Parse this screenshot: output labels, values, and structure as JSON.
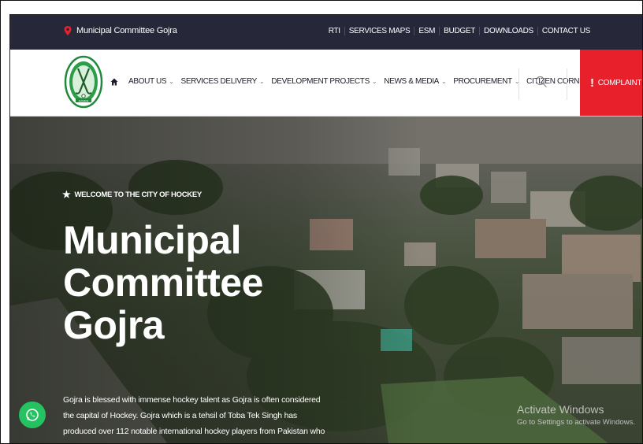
{
  "topbar": {
    "site_name": "Municipal Committee Gojra",
    "links": [
      "RTI",
      "SERVICES MAPS",
      "ESM",
      "BUDGET",
      "DOWNLOADS",
      "CONTACT US"
    ]
  },
  "nav": {
    "menu": [
      {
        "label": "ABOUT US"
      },
      {
        "label": "SERVICES DELIVERY"
      },
      {
        "label": "DEVELOPMENT PROJECTS"
      },
      {
        "label": "NEWS & MEDIA"
      },
      {
        "label": "PROCUREMENT"
      },
      {
        "label": "CITIZEN CORNER"
      }
    ],
    "complaint_label": "COMPLAINT",
    "logo_text": "GOJRA"
  },
  "hero": {
    "welcome": "WELCOME TO THE CITY OF HOCKEY",
    "title_lines": [
      "Municipal",
      "Committee",
      "Gojra"
    ],
    "description": "Gojra is blessed with immense hockey talent as Gojra is often considered the capital of Hockey. Gojra which is a tehsil of Toba Tek Singh has produced over 112 notable international hockey players from Pakistan who have"
  },
  "watermark": {
    "line1": "Activate Windows",
    "line2": "Go to Settings to activate Windows."
  },
  "colors": {
    "topbar_bg": "#26283a",
    "complaint_bg": "#e8202c",
    "whatsapp_green": "#25c262",
    "logo_green": "#1f8a3c"
  },
  "icons": {
    "brand": "location-pin-icon",
    "home": "home-icon",
    "search": "search-icon",
    "whatsapp": "whatsapp-icon",
    "welcome": "star-icon"
  }
}
